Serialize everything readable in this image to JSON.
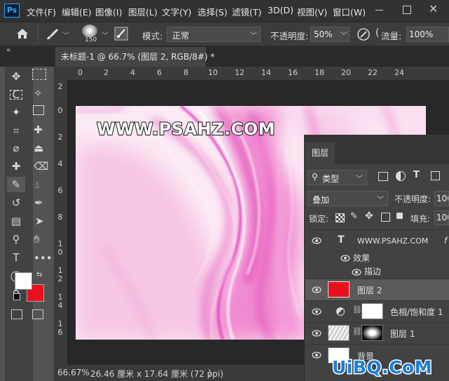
{
  "app": {
    "logo": "Ps"
  },
  "menu": [
    "文件(F)",
    "编辑(E)",
    "图像(I)",
    "图层(L)",
    "文字(Y)",
    "选择(S)",
    "滤镜(T)",
    "3D(D)",
    "视图(V)",
    "窗口(W)"
  ],
  "options": {
    "brush_size": "150",
    "mode_label": "模式:",
    "mode_value": "正常",
    "opacity_label": "不透明度:",
    "opacity_value": "50%",
    "flow_label": "流量:",
    "flow_value": "100%"
  },
  "document": {
    "tab_title": "未标题-1 @ 66.7% (图层 2, RGB/8#) *",
    "tab_collapse": "«"
  },
  "ruler": {
    "top": [
      "0",
      "2",
      "4",
      "6",
      "8",
      "10",
      "12",
      "14",
      "16",
      "18",
      "20",
      "22",
      "24"
    ],
    "left": [
      "2",
      "0",
      "2",
      "4",
      "6",
      "8",
      "10",
      "12",
      "14",
      "16"
    ]
  },
  "canvas": {
    "watermark": "WWW.PSAHZ.COM"
  },
  "status": {
    "zoom": "66.67%",
    "info": "26.46 厘米 x 17.64 厘米 (72 ppi)",
    "arrow": "〉"
  },
  "layers_panel": {
    "title": "图层",
    "filter_kind": "类型",
    "blend_mode": "叠加",
    "opacity_label": "不透明度:",
    "opacity_value": "100",
    "lock_label": "锁定:",
    "fill_label": "填充:",
    "fill_value": "100",
    "layers": [
      {
        "name": "WWW.PSAHZ.COM",
        "type_glyph": "T",
        "fx": "f"
      },
      {
        "name": "效果"
      },
      {
        "name": "描边"
      },
      {
        "name": "图层 2",
        "selected": true
      },
      {
        "name": "色相/饱和度 1"
      },
      {
        "name": "图层 1"
      },
      {
        "name": "背景"
      }
    ]
  },
  "watermark_corner": "UiBQ.CoM",
  "colors": {
    "foreground": "#ffffff",
    "background": "#e8101e",
    "accent_blue": "#31a8ff",
    "layer2_thumb": "#e8101e"
  }
}
